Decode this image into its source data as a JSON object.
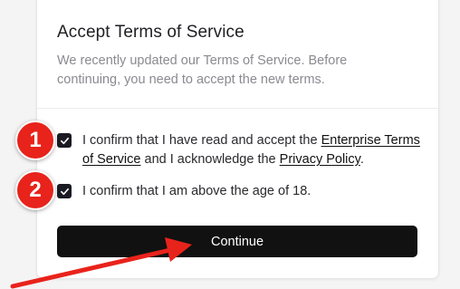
{
  "dialog": {
    "title": "Accept Terms of Service",
    "subtitle": "We recently updated our Terms of Service. Before continuing, you need to accept the new terms."
  },
  "consents": [
    {
      "checked": true,
      "text_before": "I confirm that I have read and accept the ",
      "link1": "Enterprise Terms of Service",
      "text_middle": " and I acknowledge the ",
      "link2": "Privacy Policy",
      "text_after": "."
    },
    {
      "checked": true,
      "text": "I confirm that I am above the age of 18."
    }
  ],
  "continue_label": "Continue",
  "annotations": {
    "badge1": "1",
    "badge2": "2",
    "badge_color": "#e8231b",
    "arrow_color": "#e8231b",
    "arrow_target": "continue-button"
  },
  "colors": {
    "button_bg": "#111111",
    "checkbox_bg": "#1a1a24"
  },
  "icons": {
    "checkbox": "checkmark-icon"
  }
}
